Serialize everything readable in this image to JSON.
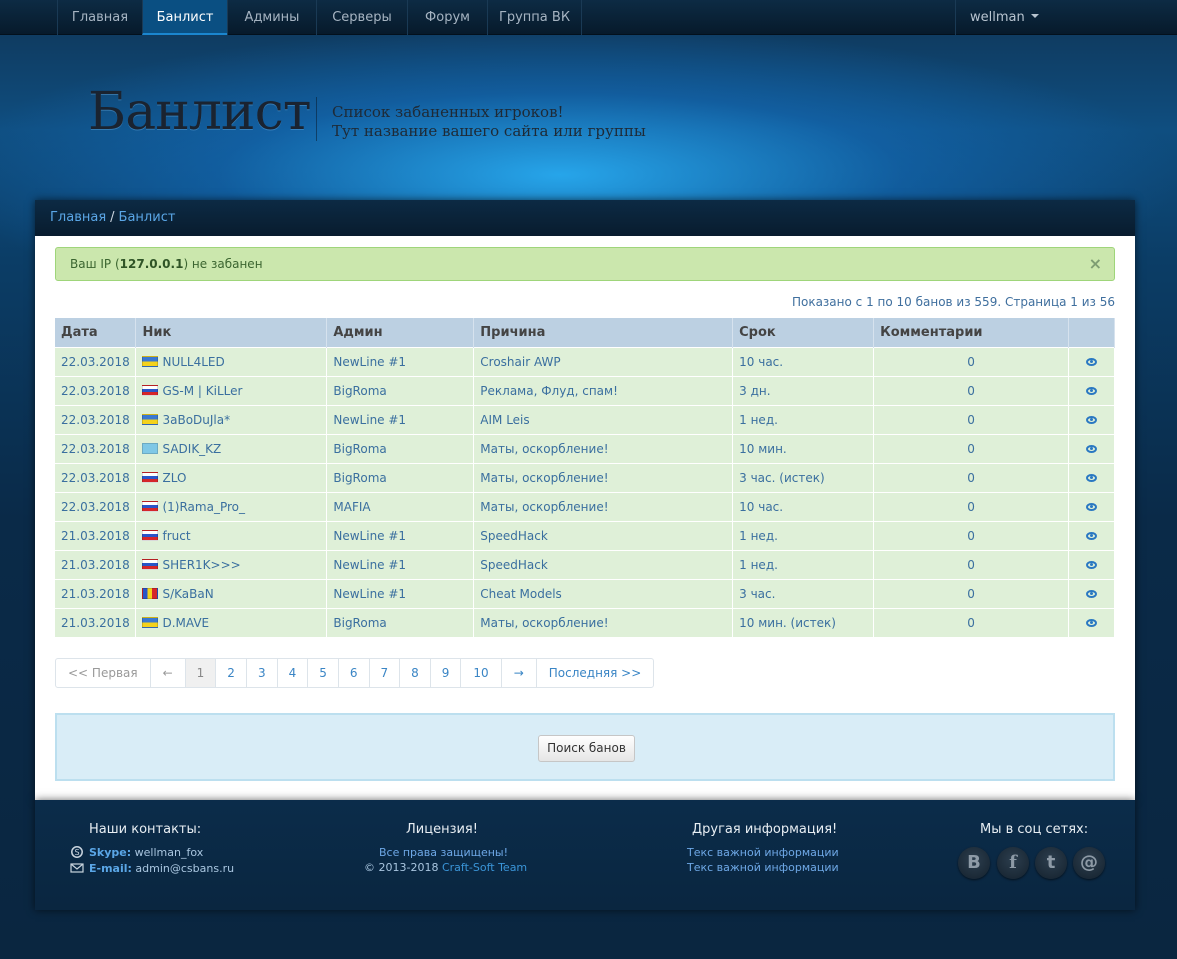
{
  "nav": {
    "items": [
      "Главная",
      "Банлист",
      "Админы",
      "Серверы",
      "Форум",
      "Группа ВК"
    ],
    "active": "Банлист",
    "user": "wellman"
  },
  "header": {
    "title": "Банлист",
    "subtitle1": "Список забаненных игроков!",
    "subtitle2": "Тут название вашего сайта или группы"
  },
  "breadcrumb": {
    "home": "Главная",
    "sep": "/",
    "current": "Банлист"
  },
  "alert": {
    "prefix": "Ваш IP (",
    "ip": "127.0.0.1",
    "suffix": ") не забанен",
    "close": "×"
  },
  "shown_info": "Показано с 1 по 10 банов из 559. Страница 1 из 56",
  "table": {
    "headers": [
      "Дата",
      "Ник",
      "Админ",
      "Причина",
      "Срок",
      "Комментарии",
      ""
    ],
    "rows": [
      {
        "date": "22.03.2018",
        "flag": "ua",
        "nick": "NULL4LED",
        "admin": "NewLine #1",
        "reason": "Croshair AWP",
        "term": "10 час.",
        "comments": "0"
      },
      {
        "date": "22.03.2018",
        "flag": "ru",
        "nick": "GS-M | KiLLer",
        "admin": "BigRoma",
        "reason": "Реклама, Флуд, спам!",
        "term": "3 дн.",
        "comments": "0"
      },
      {
        "date": "22.03.2018",
        "flag": "ua",
        "nick": "3aBoDuJla*",
        "admin": "NewLine #1",
        "reason": "AIM Leis",
        "term": "1 нед.",
        "comments": "0"
      },
      {
        "date": "22.03.2018",
        "flag": "kz",
        "nick": "SADIK_KZ",
        "admin": "BigRoma",
        "reason": "Маты, оскорбление!",
        "term": "10 мин.",
        "comments": "0"
      },
      {
        "date": "22.03.2018",
        "flag": "ru",
        "nick": "ZLO",
        "admin": "BigRoma",
        "reason": "Маты, оскорбление!",
        "term": "3 час. (истек)",
        "comments": "0"
      },
      {
        "date": "22.03.2018",
        "flag": "ru",
        "nick": "(1)Rama_Pro_",
        "admin": "MAFIA",
        "reason": "Маты, оскорбление!",
        "term": "10 час.",
        "comments": "0"
      },
      {
        "date": "21.03.2018",
        "flag": "ru",
        "nick": "fruct",
        "admin": "NewLine #1",
        "reason": "SpeedHack",
        "term": "1 нед.",
        "comments": "0"
      },
      {
        "date": "21.03.2018",
        "flag": "ru",
        "nick": "SHER1K>>>",
        "admin": "NewLine #1",
        "reason": "SpeedHack",
        "term": "1 нед.",
        "comments": "0"
      },
      {
        "date": "21.03.2018",
        "flag": "md",
        "nick": "S/KaBaN",
        "admin": "NewLine #1",
        "reason": "Cheat Models",
        "term": "3 час.",
        "comments": "0"
      },
      {
        "date": "21.03.2018",
        "flag": "ua",
        "nick": "D.MAVE",
        "admin": "BigRoma",
        "reason": "Маты, оскорбление!",
        "term": "10 мин. (истек)",
        "comments": "0"
      }
    ]
  },
  "pagination": {
    "first": "<< Первая",
    "prev": "←",
    "pages": [
      "1",
      "2",
      "3",
      "4",
      "5",
      "6",
      "7",
      "8",
      "9",
      "10"
    ],
    "current": "1",
    "next": "→",
    "last": "Последняя >>"
  },
  "search": {
    "button": "Поиск банов"
  },
  "footer": {
    "contacts_title": "Наши контакты:",
    "skype_label": "Skype:",
    "skype_value": "wellman_fox",
    "email_label": "E-mail:",
    "email_value": "admin@csbans.ru",
    "license_title": "Лицензия!",
    "license_line1": "Все права защищены!",
    "license_copy": "© 2013-2018",
    "license_team": "Craft-Soft Team",
    "other_title": "Другая информация!",
    "other_link1": "Текс важной информации",
    "other_link2": "Текс важной информации",
    "social_title": "Мы в соц сетях:",
    "social": [
      {
        "icon": "vk-icon",
        "glyph": "B"
      },
      {
        "icon": "facebook-icon",
        "glyph": "f"
      },
      {
        "icon": "twitter-icon",
        "glyph": "t"
      },
      {
        "icon": "mail-icon",
        "glyph": "@"
      }
    ]
  },
  "colors": {
    "row_bg": "#dff0d8",
    "header_bg": "#bcd0e2",
    "link": "#3a6f9f",
    "nav_active": "#0a4f82"
  }
}
